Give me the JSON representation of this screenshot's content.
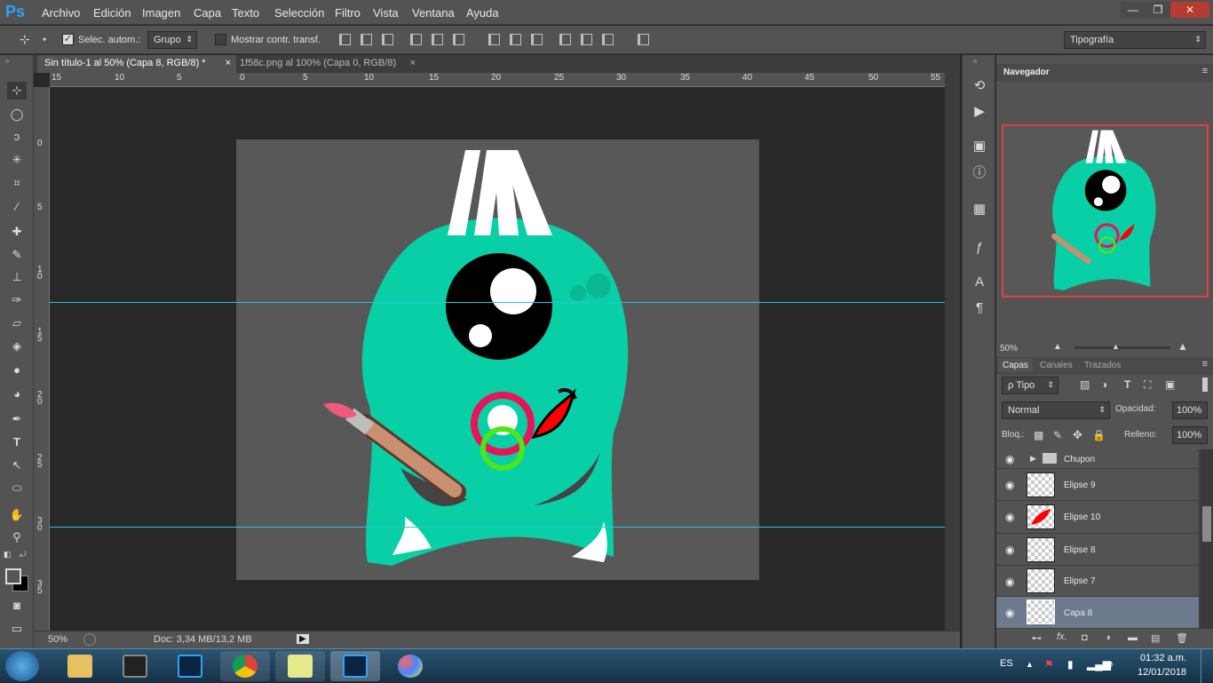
{
  "menubar": {
    "logo": "Ps",
    "items": [
      "Archivo",
      "Edición",
      "Imagen",
      "Capa",
      "Texto",
      "Selección",
      "Filtro",
      "Vista",
      "Ventana",
      "Ayuda"
    ],
    "win_min": "—",
    "win_max": "❐",
    "win_close": "✕"
  },
  "options": {
    "auto_select_label": "Selec. autom.:",
    "group_value": "Grupo",
    "show_transform_label": "Mostrar contr. transf.",
    "workspace_value": "Tipografía"
  },
  "tabs": [
    {
      "label": "Sin título-1 al 50% (Capa 8, RGB/8) *",
      "close": "×"
    },
    {
      "label": "1f58c.png al 100% (Capa 0, RGB/8)",
      "close": "×"
    }
  ],
  "ruler": {
    "top": [
      "15",
      "10",
      "5",
      "0",
      "5",
      "10",
      "15",
      "20",
      "25",
      "30",
      "35",
      "40",
      "45",
      "50",
      "55"
    ],
    "left": [
      "0",
      "5",
      "1\n0",
      "1\n5",
      "2\n0",
      "2\n5",
      "3\n0",
      "3\n5"
    ]
  },
  "status": {
    "zoom": "50%",
    "doc": "Doc: 3,34 MB/13,2 MB"
  },
  "navigator": {
    "title": "Navegador",
    "zoom": "50%"
  },
  "layers_panel": {
    "tabs": [
      "Capas",
      "Canales",
      "Trazados"
    ],
    "filter": "ρ Tipo",
    "blend": "Normal",
    "opacity_label": "Opacidad:",
    "opacity": "100%",
    "lock_label": "Bloq.:",
    "fill_label": "Relleno:",
    "fill": "100%",
    "layers": [
      {
        "name": "Chupon",
        "type": "group"
      },
      {
        "name": "Elipse 9",
        "type": "layer"
      },
      {
        "name": "Elipse 10",
        "type": "layer"
      },
      {
        "name": "Elipse 8",
        "type": "layer"
      },
      {
        "name": "Elipse 7",
        "type": "layer"
      },
      {
        "name": "Capa 8",
        "type": "layer",
        "selected": true
      }
    ]
  },
  "taskbar": {
    "lang": "ES",
    "time": "01:32 a.m.",
    "date": "12/01/2018"
  },
  "colors": {
    "monster": "#08cfa6",
    "pacifier": "#e8145a",
    "ring": "#4ee61a",
    "doc_bg": "#585858",
    "guide": "#26c6da"
  }
}
